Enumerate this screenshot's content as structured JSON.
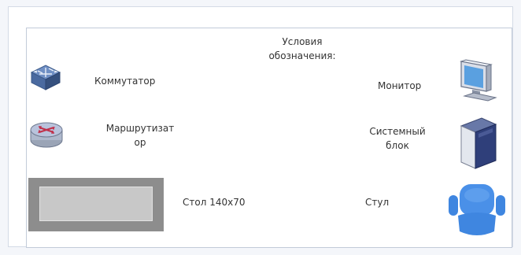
{
  "legend": {
    "title_line1": "Условия",
    "title_line2": "обозначения:",
    "items": {
      "switch": {
        "label": "Коммутатор",
        "icon": "network-switch-icon"
      },
      "router": {
        "label_line1": "Маршрутизат",
        "label_line2": "ор",
        "icon": "router-icon"
      },
      "table": {
        "label": "Стол 140x70"
      },
      "monitor": {
        "label": "Монитор",
        "icon": "monitor-icon"
      },
      "system_unit": {
        "label_line1": "Системный",
        "label_line2": "блок",
        "icon": "system-unit-icon"
      },
      "chair": {
        "label": "Стул",
        "icon": "chair-icon"
      }
    }
  },
  "colors": {
    "table_outer": "#8d8d8d",
    "table_inner": "#c8c8c8",
    "chair": "#3f86e0",
    "switch": "#5a7fb5",
    "router": "#8a9cc4"
  }
}
